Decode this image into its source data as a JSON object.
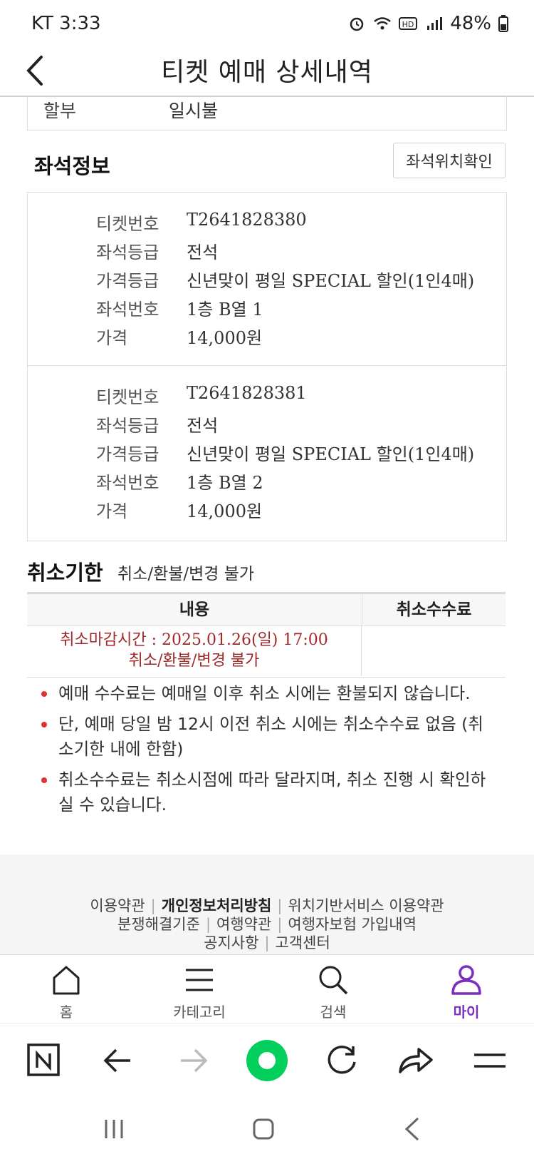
{
  "status_bar": {
    "carrier_time": "KT 3:33",
    "battery": "48%"
  },
  "header": {
    "title": "티켓 예매 상세내역"
  },
  "payment": {
    "label": "할부",
    "value": "일시불"
  },
  "seat_info": {
    "title": "좌석정보",
    "location_button": "좌석위치확인",
    "tickets": [
      {
        "rows": [
          {
            "label": "티켓번호",
            "value": "T2641828380"
          },
          {
            "label": "좌석등급",
            "value": "전석"
          },
          {
            "label": "가격등급",
            "value": "신년맞이 평일 SPECIAL 할인(1인4매)"
          },
          {
            "label": "좌석번호",
            "value": "1층 B열 1"
          },
          {
            "label": "가격",
            "value": "14,000원"
          }
        ]
      },
      {
        "rows": [
          {
            "label": "티켓번호",
            "value": "T2641828381"
          },
          {
            "label": "좌석등급",
            "value": "전석"
          },
          {
            "label": "가격등급",
            "value": "신년맞이 평일 SPECIAL 할인(1인4매)"
          },
          {
            "label": "좌석번호",
            "value": "1층 B열 2"
          },
          {
            "label": "가격",
            "value": "14,000원"
          }
        ]
      }
    ]
  },
  "cancellation": {
    "title": "취소기한",
    "subtitle": "취소/환불/변경 불가",
    "headers": {
      "content": "내용",
      "fee": "취소수수료"
    },
    "row": {
      "line1": "취소마감시간 : 2025.01.26(일) 17:00",
      "line2": "취소/환불/변경 불가",
      "fee": ""
    },
    "notes": [
      "예매 수수료는 예매일 이후 취소 시에는 환불되지 않습니다.",
      "단, 예매 당일 밤 12시 이전 취소 시에는 취소수수료 없음 (취소기한 내에 한함)",
      "취소수수료는 취소시점에 따라 달라지며, 취소 진행 시 확인하실 수 있습니다."
    ]
  },
  "footer": {
    "row1": [
      "이용약관",
      "개인정보처리방침",
      "위치기반서비스 이용약관"
    ],
    "row2": [
      "분쟁해결기준",
      "여행약관",
      "여행자보험 가입내역"
    ],
    "row3": [
      "공지사항",
      "고객센터"
    ]
  },
  "bottom_nav": {
    "items": [
      {
        "label": "홈",
        "icon": "home-icon"
      },
      {
        "label": "카테고리",
        "icon": "menu-icon"
      },
      {
        "label": "검색",
        "icon": "search-icon"
      },
      {
        "label": "마이",
        "icon": "user-icon",
        "active": true
      }
    ],
    "active_color": "#7b2fbf"
  },
  "colors": {
    "accent_purple": "#7b2fbf",
    "notice_red": "#a02a2a",
    "bullet_red": "#dd3333",
    "naver_green": "#03cf5d"
  }
}
